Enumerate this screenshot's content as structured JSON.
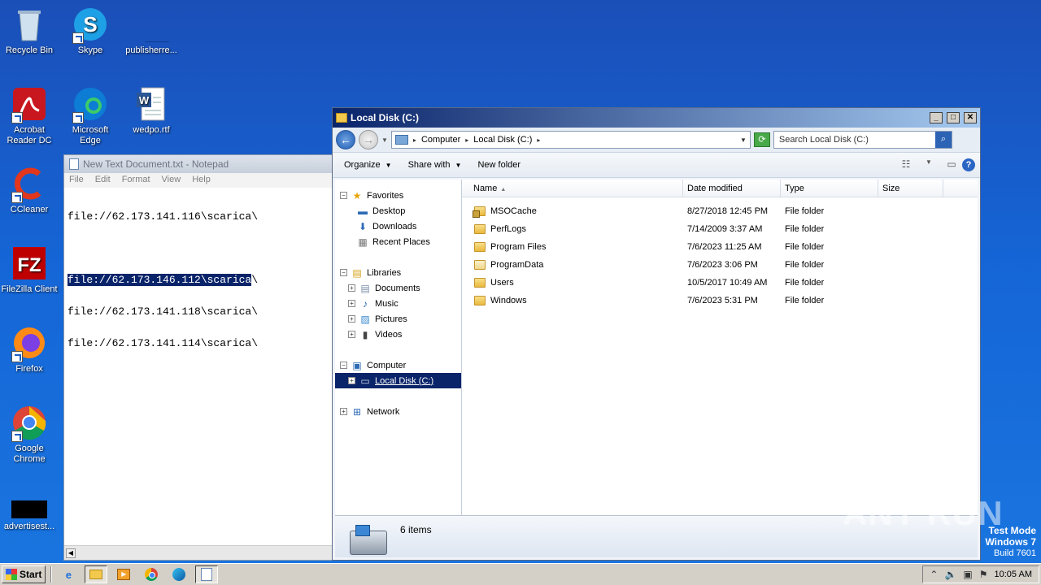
{
  "desktop": {
    "icons": [
      {
        "label": "Recycle Bin",
        "icon": "recycle-bin-icon"
      },
      {
        "label": "Skype",
        "icon": "skype-icon"
      },
      {
        "label": "publisherre...",
        "icon": "file-icon"
      },
      {
        "label": "Acrobat Reader DC",
        "icon": "acrobat-icon"
      },
      {
        "label": "Microsoft Edge",
        "icon": "edge-icon"
      },
      {
        "label": "wedpo.rtf",
        "icon": "word-document-icon"
      },
      {
        "label": "CCleaner",
        "icon": "ccleaner-icon"
      },
      {
        "label": "FileZilla Client",
        "icon": "filezilla-icon"
      },
      {
        "label": "Firefox",
        "icon": "firefox-icon"
      },
      {
        "label": "Google Chrome",
        "icon": "chrome-icon"
      },
      {
        "label": "advertisest...",
        "icon": "black-file-icon"
      }
    ]
  },
  "notepad": {
    "title": "New Text Document.txt - Notepad",
    "menu": [
      "File",
      "Edit",
      "Format",
      "View",
      "Help"
    ],
    "lines": [
      "file://62.173.141.116\\scarica\\",
      "",
      "file://62.173.146.112\\scarica\\",
      "file://62.173.141.118\\scarica\\",
      "file://62.173.141.114\\scarica\\"
    ],
    "selected_text": "file://62.173.146.112\\scarica"
  },
  "explorer": {
    "title": "Local Disk (C:)",
    "breadcrumb": [
      "Computer",
      "Local Disk (C:)"
    ],
    "search_placeholder": "Search Local Disk (C:)",
    "toolbar": {
      "organize": "Organize",
      "share_with": "Share with",
      "new_folder": "New folder"
    },
    "nav": {
      "favorites": "Favorites",
      "desktop": "Desktop",
      "downloads": "Downloads",
      "recent_places": "Recent Places",
      "libraries": "Libraries",
      "documents": "Documents",
      "music": "Music",
      "pictures": "Pictures",
      "videos": "Videos",
      "computer": "Computer",
      "local_disk": "Local Disk (C:)",
      "network": "Network"
    },
    "columns": {
      "name": "Name",
      "date": "Date modified",
      "type": "Type",
      "size": "Size"
    },
    "files": [
      {
        "name": "MSOCache",
        "date": "8/27/2018 12:45 PM",
        "type": "File folder"
      },
      {
        "name": "PerfLogs",
        "date": "7/14/2009 3:37 AM",
        "type": "File folder"
      },
      {
        "name": "Program Files",
        "date": "7/6/2023 11:25 AM",
        "type": "File folder"
      },
      {
        "name": "ProgramData",
        "date": "7/6/2023 3:06 PM",
        "type": "File folder"
      },
      {
        "name": "Users",
        "date": "10/5/2017 10:49 AM",
        "type": "File folder"
      },
      {
        "name": "Windows",
        "date": "7/6/2023 5:31 PM",
        "type": "File folder"
      }
    ],
    "item_count": "6 items"
  },
  "watermark": "ANY RUN",
  "test_mode": {
    "line1": "Test Mode",
    "line2": "Windows 7",
    "line3": "Build 7601"
  },
  "taskbar": {
    "start": "Start",
    "clock": "10:05 AM"
  }
}
